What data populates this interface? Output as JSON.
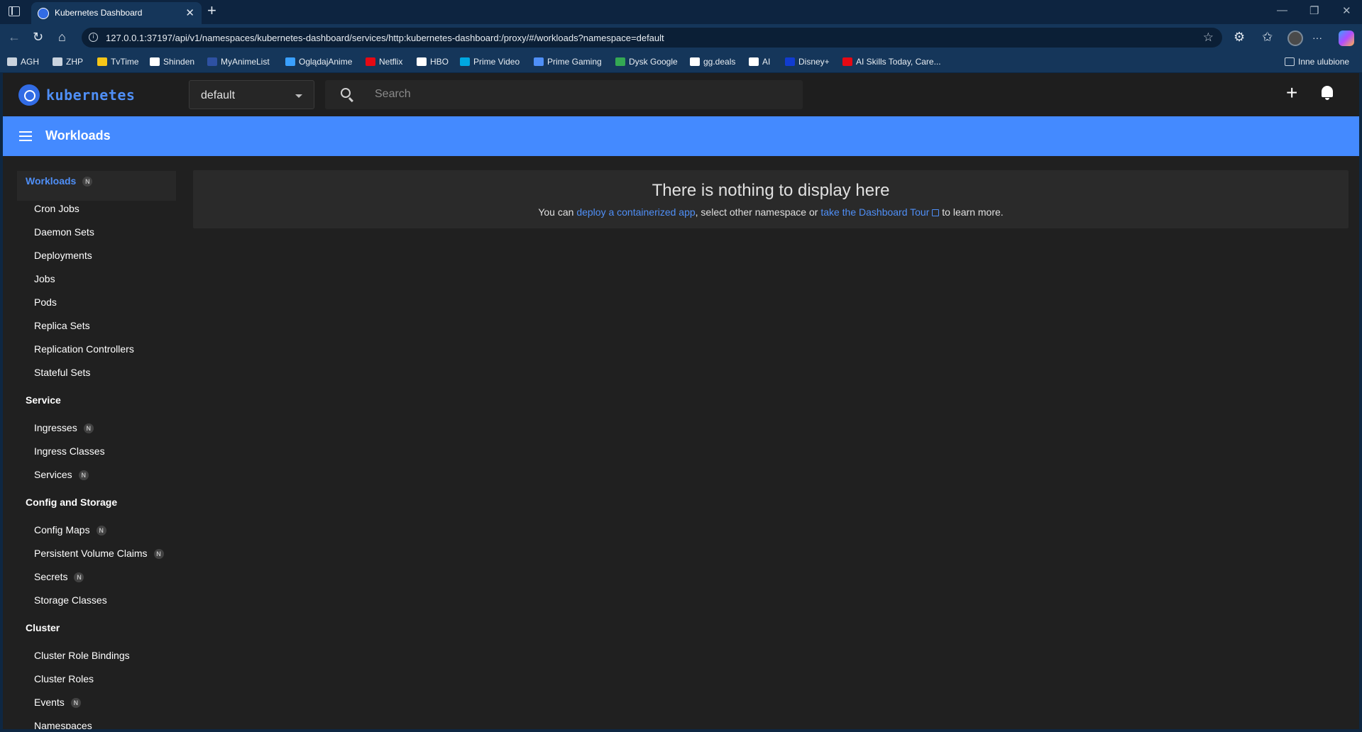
{
  "browser": {
    "tab_title": "Kubernetes Dashboard",
    "tab_close": "✕",
    "new_tab": "+",
    "url": "127.0.0.1:37197/api/v1/namespaces/kubernetes-dashboard/services/http:kubernetes-dashboard:/proxy/#/workloads?namespace=default",
    "window_controls": {
      "minimize": "—",
      "restore": "❐",
      "close": "✕"
    },
    "nav": {
      "back": "←",
      "reload": "↻",
      "home": "⌂"
    },
    "actions": {
      "star": "☆",
      "extensions": "⚙",
      "favorites": "✩",
      "more": "···"
    },
    "bookmarks": [
      {
        "label": "AGH",
        "color": "#c9d3de"
      },
      {
        "label": "ZHP",
        "color": "#c9d3de"
      },
      {
        "label": "TvTime",
        "color": "#f5c518"
      },
      {
        "label": "Shinden",
        "color": "#ffffff"
      },
      {
        "label": "MyAnimeList",
        "color": "#2e51a2"
      },
      {
        "label": "OglądajAnime",
        "color": "#3aa0ff"
      },
      {
        "label": "Netflix",
        "color": "#e50914"
      },
      {
        "label": "HBO",
        "color": "#ffffff"
      },
      {
        "label": "Prime Video",
        "color": "#00a8e1"
      },
      {
        "label": "Prime Gaming",
        "color": "#4f8ff7"
      },
      {
        "label": "Dysk Google",
        "color": "#34a853"
      },
      {
        "label": "gg.deals",
        "color": "#ffffff"
      },
      {
        "label": "AI",
        "color": "#ffffff"
      },
      {
        "label": "Disney+",
        "color": "#113ccf"
      },
      {
        "label": "AI Skills Today, Care...",
        "color": "#e50914"
      }
    ],
    "other_bookmarks": "Inne ulubione"
  },
  "k8s": {
    "brand": "kubernetes",
    "namespace": "default",
    "search_placeholder": "Search",
    "plus": "+",
    "toolbar_title": "Workloads",
    "accent": "#448aff"
  },
  "sidebar": {
    "sections": [
      {
        "title": "Workloads",
        "badge": "N",
        "active": true,
        "items": [
          {
            "label": "Cron Jobs"
          },
          {
            "label": "Daemon Sets"
          },
          {
            "label": "Deployments"
          },
          {
            "label": "Jobs"
          },
          {
            "label": "Pods"
          },
          {
            "label": "Replica Sets"
          },
          {
            "label": "Replication Controllers"
          },
          {
            "label": "Stateful Sets"
          }
        ]
      },
      {
        "title": "Service",
        "items": [
          {
            "label": "Ingresses",
            "badge": "N"
          },
          {
            "label": "Ingress Classes"
          },
          {
            "label": "Services",
            "badge": "N"
          }
        ]
      },
      {
        "title": "Config and Storage",
        "items": [
          {
            "label": "Config Maps",
            "badge": "N"
          },
          {
            "label": "Persistent Volume Claims",
            "badge": "N"
          },
          {
            "label": "Secrets",
            "badge": "N"
          },
          {
            "label": "Storage Classes"
          }
        ]
      },
      {
        "title": "Cluster",
        "items": [
          {
            "label": "Cluster Role Bindings"
          },
          {
            "label": "Cluster Roles"
          },
          {
            "label": "Events",
            "badge": "N"
          },
          {
            "label": "Namespaces"
          }
        ]
      }
    ]
  },
  "main": {
    "empty_title": "There is nothing to display here",
    "text_1": "You can ",
    "link_deploy": "deploy a containerized app",
    "text_2": ", select other namespace or ",
    "link_tour": "take the Dashboard Tour",
    "text_3": " to learn more."
  }
}
